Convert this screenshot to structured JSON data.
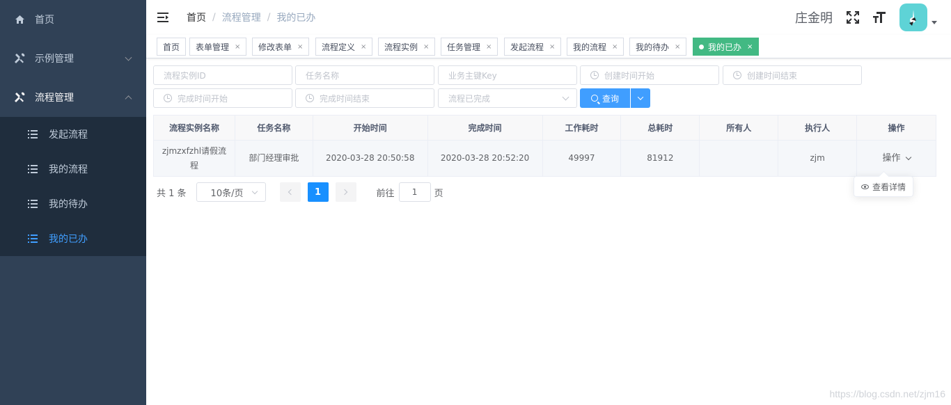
{
  "sidebar": {
    "home": "首页",
    "example_mgmt": "示例管理",
    "process_mgmt": "流程管理",
    "submenu": [
      "发起流程",
      "我的流程",
      "我的待办",
      "我的已办"
    ],
    "active_item": "我的已办"
  },
  "navbar": {
    "breadcrumb": [
      "首页",
      "流程管理",
      "我的已办"
    ],
    "username": "庄金明"
  },
  "tags": [
    {
      "label": "首页",
      "closable": false,
      "active": false
    },
    {
      "label": "表单管理",
      "closable": true,
      "active": false
    },
    {
      "label": "修改表单",
      "closable": true,
      "active": false
    },
    {
      "label": "流程定义",
      "closable": true,
      "active": false
    },
    {
      "label": "流程实例",
      "closable": true,
      "active": false
    },
    {
      "label": "任务管理",
      "closable": true,
      "active": false
    },
    {
      "label": "发起流程",
      "closable": true,
      "active": false
    },
    {
      "label": "我的流程",
      "closable": true,
      "active": false
    },
    {
      "label": "我的待办",
      "closable": true,
      "active": false
    },
    {
      "label": "我的已办",
      "closable": true,
      "active": true
    }
  ],
  "tag_close": "×",
  "filters": {
    "process_instance_id": "流程实例ID",
    "task_name": "任务名称",
    "business_key": "业务主键Key",
    "create_time_start": "创建时间开始",
    "create_time_end": "创建时间结束",
    "finish_time_start": "完成时间开始",
    "finish_time_end": "完成时间结束",
    "is_finished": "流程已完成",
    "query_button": "查询"
  },
  "table": {
    "headers": [
      "流程实例名称",
      "任务名称",
      "开始时间",
      "完成时间",
      "工作耗时",
      "总耗时",
      "所有人",
      "执行人",
      "操作"
    ],
    "rows": [
      {
        "instance_name": "zjmzxfzhl请假流程",
        "task_name": "部门经理审批",
        "start_time": "2020-03-28 20:50:58",
        "finish_time": "2020-03-28 20:52:20",
        "work_duration": "49997",
        "total_duration": "81912",
        "owner": "",
        "assignee": "zjm",
        "action_label": "操作"
      }
    ]
  },
  "dropdown": {
    "view_detail": "查看详情"
  },
  "pagination": {
    "total_text": "共 1 条",
    "page_size": "10条/页",
    "current_page": "1",
    "jump_label": "前往",
    "jump_value": "1",
    "page_suffix": "页"
  },
  "watermark": "https://blog.csdn.net/zjm16",
  "colors": {
    "sidebar_bg": "#304156",
    "submenu_bg": "#1f2d3d",
    "active_menu": "#409eff",
    "active_tag": "#42b983",
    "primary": "#409eff",
    "avatar_bg": "#5ed3d6"
  }
}
